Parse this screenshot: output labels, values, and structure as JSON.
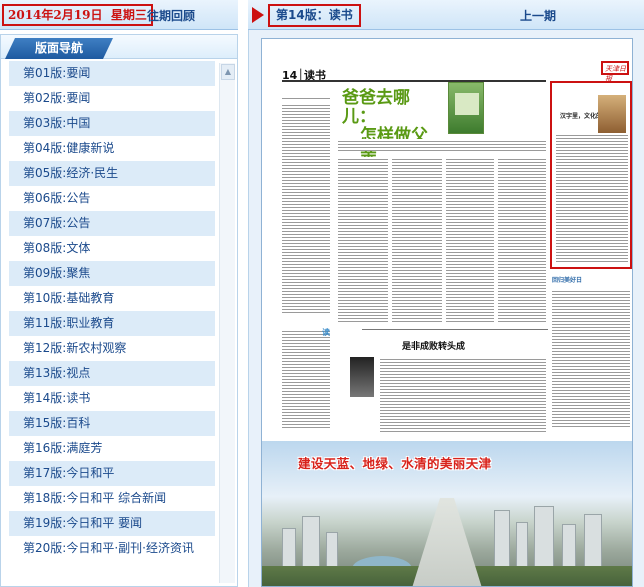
{
  "header": {
    "date": "2014年2月19日",
    "weekday": "星期三",
    "past_link": "往期回顾",
    "edition_label": "第14版：读书",
    "prev_link": "上一期"
  },
  "nav": {
    "title": "版面导航",
    "items": [
      "第01版:要闻",
      "第02版:要闻",
      "第03版:中国",
      "第04版:健康新说",
      "第05版:经济·民生",
      "第06版:公告",
      "第07版:公告",
      "第08版:文体",
      "第09版:聚焦",
      "第10版:基础教育",
      "第11版:职业教育",
      "第12版:新农村观察",
      "第13版:视点",
      "第14版:读书",
      "第15版:百科",
      "第16版:满庭芳",
      "第17版:今日和平",
      "第18版:今日和平 综合新闻",
      "第19版:今日和平 要闻",
      "第20版:今日和平·副刊·经济资讯"
    ]
  },
  "paper": {
    "page_number": "14",
    "section": "读书",
    "masthead_stamp": "天津日报",
    "headline_main_1": "爸爸去哪儿：",
    "headline_main_2": "怎样做父亲",
    "headline_right": "汉字里，文化的传承",
    "headline_right_2": "回归美好日",
    "headline_mid": "是非成败转头成",
    "read_label": "读",
    "banner_title": "建设天蓝、地绿、水清的美丽天津"
  },
  "colors": {
    "accent_red": "#cc1111",
    "link_blue": "#1b4a8c",
    "nav_tab_blue": "#1e5aa0",
    "row_alt": "#dcebf8",
    "headline_green": "#5a9a14"
  }
}
